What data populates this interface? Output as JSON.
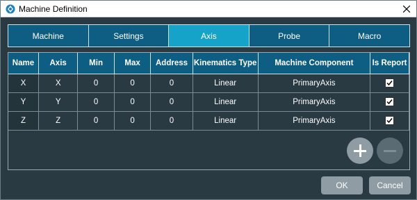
{
  "window": {
    "title": "Machine Definition",
    "icon": "app-logo-icon",
    "close_icon": "close-icon"
  },
  "tabs": [
    {
      "label": "Machine",
      "active": false
    },
    {
      "label": "Settings",
      "active": false
    },
    {
      "label": "Axis",
      "active": true
    },
    {
      "label": "Probe",
      "active": false
    },
    {
      "label": "Macro",
      "active": false
    }
  ],
  "table": {
    "headers": [
      "Name",
      "Axis",
      "Min",
      "Max",
      "Address",
      "Kinematics Type",
      "Machine Component",
      "Is Report"
    ],
    "rows": [
      {
        "name": "X",
        "axis": "X",
        "min": "0",
        "max": "0",
        "address": "0",
        "kinematics": "Linear",
        "component": "PrimaryAxis",
        "is_report": true
      },
      {
        "name": "Y",
        "axis": "Y",
        "min": "0",
        "max": "0",
        "address": "0",
        "kinematics": "Linear",
        "component": "PrimaryAxis",
        "is_report": true
      },
      {
        "name": "Z",
        "axis": "Z",
        "min": "0",
        "max": "0",
        "address": "0",
        "kinematics": "Linear",
        "component": "PrimaryAxis",
        "is_report": true
      }
    ]
  },
  "controls": {
    "add_icon": "plus-icon",
    "remove_icon": "minus-icon"
  },
  "footer": {
    "ok_label": "OK",
    "cancel_label": "Cancel"
  },
  "colors": {
    "background": "#2a3a42",
    "header": "#0e5e84",
    "active_tab": "#15a3c9",
    "button": "#8f9ca3"
  }
}
